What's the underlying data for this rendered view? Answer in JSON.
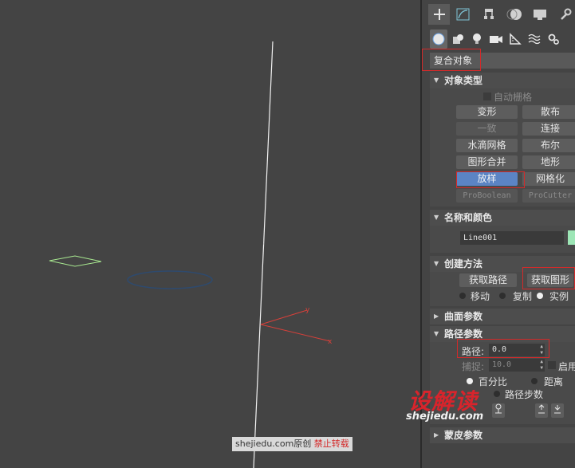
{
  "viewport": {
    "gizmo_y_label": "y",
    "gizmo_x_label": "x"
  },
  "command_panel": {
    "tabs": [
      {
        "name": "create-tab",
        "icon": "plus-icon"
      },
      {
        "name": "modify-tab",
        "icon": "modify-curve-icon"
      },
      {
        "name": "hierarchy-tab",
        "icon": "hierarchy-icon"
      },
      {
        "name": "motion-tab",
        "icon": "motion-circle-icon"
      },
      {
        "name": "display-tab",
        "icon": "display-monitor-icon"
      },
      {
        "name": "utilities-tab",
        "icon": "wrench-icon"
      }
    ],
    "subtabs": [
      {
        "name": "geometry",
        "icon": "sphere-icon"
      },
      {
        "name": "shapes",
        "icon": "shapes-icon"
      },
      {
        "name": "lights",
        "icon": "light-bulb-icon"
      },
      {
        "name": "cameras",
        "icon": "camera-icon"
      },
      {
        "name": "helpers",
        "icon": "ruler-triangle-icon"
      },
      {
        "name": "space-warps",
        "icon": "wave-icon"
      },
      {
        "name": "systems",
        "icon": "gears-icon"
      }
    ],
    "category_dropdown": "复合对象",
    "object_type": {
      "title": "对象类型",
      "autogrid": "自动栅格",
      "buttons": [
        {
          "label": "变形",
          "enabled": true
        },
        {
          "label": "散布",
          "enabled": true
        },
        {
          "label": "一致",
          "enabled": false
        },
        {
          "label": "连接",
          "enabled": true
        },
        {
          "label": "水滴网格",
          "enabled": true
        },
        {
          "label": "布尔",
          "enabled": true
        },
        {
          "label": "图形合并",
          "enabled": true
        },
        {
          "label": "地形",
          "enabled": true
        },
        {
          "label": "放样",
          "enabled": true,
          "selected": true
        },
        {
          "label": "网格化",
          "enabled": true
        },
        {
          "label": "ProBoolean",
          "enabled": false
        },
        {
          "label": "ProCutter",
          "enabled": false
        }
      ]
    },
    "name_color": {
      "title": "名称和颜色",
      "name_value": "Line001",
      "color": "#9de6b6"
    },
    "creation_method": {
      "title": "创建方法",
      "get_path": "获取路径",
      "get_shape": "获取图形",
      "options": [
        {
          "label": "移动",
          "checked": false
        },
        {
          "label": "复制",
          "checked": false
        },
        {
          "label": "实例",
          "checked": true
        }
      ]
    },
    "surface_params": {
      "title": "曲面参数"
    },
    "path_params": {
      "title": "路径参数",
      "path_label": "路径:",
      "path_value": "0.0",
      "snap_label": "捕捉:",
      "snap_value": "10.0",
      "enable_label": "启用",
      "percentage": "百分比",
      "distance": "距离",
      "path_steps": "路径步数"
    },
    "skin_params": {
      "title": "蒙皮参数"
    }
  },
  "watermark": {
    "logo": "设解读",
    "url": "shejiedu.com",
    "credit_main": "shejiedu.com原创",
    "credit_warning": "禁止转载"
  },
  "colors": {
    "viewport_bg": "#444444",
    "highlight_red": "#d22a2a",
    "selected_button": "#5b84c4",
    "rect_shape": "#a8e890",
    "ellipse_shape": "#2e4a6e"
  }
}
